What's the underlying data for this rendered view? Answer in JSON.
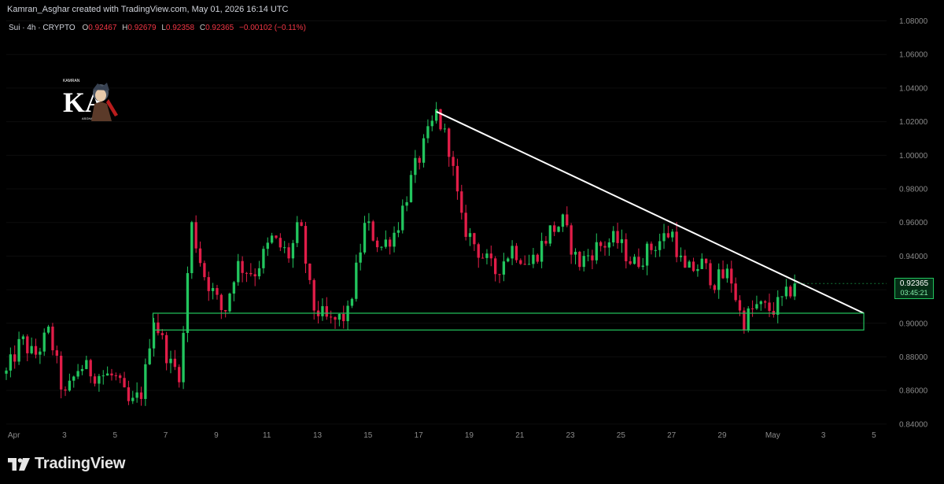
{
  "header": {
    "attribution": "Kamran_Asghar created with TradingView.com, May 01, 2026 16:14 UTC",
    "symbol_line": "Sui · 4h · CRYPTO",
    "ohlc": [
      {
        "k": "O",
        "v": "0.92467"
      },
      {
        "k": "H",
        "v": "0.92679"
      },
      {
        "k": "L",
        "v": "0.92358"
      },
      {
        "k": "C",
        "v": "0.92365"
      }
    ],
    "change": "−0.00102 (−0.11%)"
  },
  "logo": {
    "text": "KA",
    "top_text": "KAMRAN",
    "bottom_text": "ASGHAR"
  },
  "brand": {
    "name": "TradingView",
    "icon": "tradingview-logo-icon"
  },
  "last_price": {
    "price": "0.92365",
    "countdown": "03:45:21",
    "color": "#22c55e"
  },
  "colors": {
    "up": "#22c55e",
    "down": "#e11d48",
    "trendline": "#ffffff",
    "zone": "#22c55e",
    "axis_text": "#8a8a8a"
  },
  "chart_data": {
    "type": "candlestick",
    "interval": "4h",
    "x_axis": {
      "tick_labels": [
        "Apr",
        "3",
        "5",
        "7",
        "9",
        "11",
        "13",
        "15",
        "17",
        "19",
        "21",
        "23",
        "25",
        "27",
        "29",
        "May",
        "3",
        "5"
      ],
      "tick_days": [
        1,
        3,
        5,
        7,
        9,
        11,
        13,
        15,
        17,
        19,
        21,
        23,
        25,
        27,
        29,
        31,
        33,
        35
      ],
      "range_days": [
        0.7,
        35.5
      ]
    },
    "y_axis": {
      "ticks": [
        0.84,
        0.86,
        0.88,
        0.9,
        0.92,
        0.94,
        0.96,
        0.98,
        1.0,
        1.02,
        1.04,
        1.06,
        1.08
      ],
      "tick_labels": [
        "0.84000",
        "0.86000",
        "0.88000",
        "0.90000",
        "0.92000",
        "0.94000",
        "0.96000",
        "0.98000",
        "1.00000",
        "1.02000",
        "1.04000",
        "1.06000",
        "1.08000"
      ],
      "range": [
        0.839,
        1.084
      ]
    },
    "key_points": [
      {
        "day": 0.7,
        "close": 0.87
      },
      {
        "day": 1.3,
        "close": 0.89
      },
      {
        "day": 1.8,
        "close": 0.88
      },
      {
        "day": 2.4,
        "close": 0.895
      },
      {
        "day": 3.0,
        "close": 0.855
      },
      {
        "day": 3.6,
        "close": 0.875
      },
      {
        "day": 4.2,
        "close": 0.87
      },
      {
        "day": 5.0,
        "close": 0.868
      },
      {
        "day": 5.6,
        "close": 0.85
      },
      {
        "day": 6.1,
        "close": 0.86
      },
      {
        "day": 6.5,
        "close": 0.905
      },
      {
        "day": 7.2,
        "close": 0.875
      },
      {
        "day": 7.6,
        "close": 0.87
      },
      {
        "day": 8.0,
        "close": 0.96
      },
      {
        "day": 8.5,
        "close": 0.93
      },
      {
        "day": 9.3,
        "close": 0.905
      },
      {
        "day": 9.8,
        "close": 0.935
      },
      {
        "day": 10.5,
        "close": 0.93
      },
      {
        "day": 11.2,
        "close": 0.95
      },
      {
        "day": 11.9,
        "close": 0.94
      },
      {
        "day": 12.3,
        "close": 0.96
      },
      {
        "day": 12.8,
        "close": 0.91
      },
      {
        "day": 13.5,
        "close": 0.9
      },
      {
        "day": 14.2,
        "close": 0.905
      },
      {
        "day": 14.9,
        "close": 0.96
      },
      {
        "day": 15.5,
        "close": 0.945
      },
      {
        "day": 16.1,
        "close": 0.955
      },
      {
        "day": 16.8,
        "close": 0.99
      },
      {
        "day": 17.2,
        "close": 1.005
      },
      {
        "day": 17.7,
        "close": 1.025
      },
      {
        "day": 18.2,
        "close": 1.005
      },
      {
        "day": 18.7,
        "close": 0.96
      },
      {
        "day": 19.3,
        "close": 0.945
      },
      {
        "day": 20.0,
        "close": 0.93
      },
      {
        "day": 20.7,
        "close": 0.945
      },
      {
        "day": 21.4,
        "close": 0.935
      },
      {
        "day": 22.2,
        "close": 0.955
      },
      {
        "day": 22.7,
        "close": 0.96
      },
      {
        "day": 23.3,
        "close": 0.935
      },
      {
        "day": 24.0,
        "close": 0.945
      },
      {
        "day": 24.8,
        "close": 0.95
      },
      {
        "day": 25.5,
        "close": 0.935
      },
      {
        "day": 26.2,
        "close": 0.945
      },
      {
        "day": 27.0,
        "close": 0.955
      },
      {
        "day": 27.5,
        "close": 0.93
      },
      {
        "day": 28.2,
        "close": 0.935
      },
      {
        "day": 28.7,
        "close": 0.925
      },
      {
        "day": 29.3,
        "close": 0.93
      },
      {
        "day": 29.8,
        "close": 0.9
      },
      {
        "day": 30.3,
        "close": 0.91
      },
      {
        "day": 31.0,
        "close": 0.908
      },
      {
        "day": 31.5,
        "close": 0.915
      },
      {
        "day": 31.9,
        "close": 0.925
      }
    ],
    "last_close": 0.92365,
    "annotations": [
      {
        "type": "trendline",
        "from": {
          "day": 17.7,
          "price": 1.026
        },
        "to": {
          "day": 34.6,
          "price": 0.906
        }
      },
      {
        "type": "support_zone",
        "day_from": 6.5,
        "day_to": 34.6,
        "price_low": 0.896,
        "price_high": 0.906
      }
    ]
  }
}
